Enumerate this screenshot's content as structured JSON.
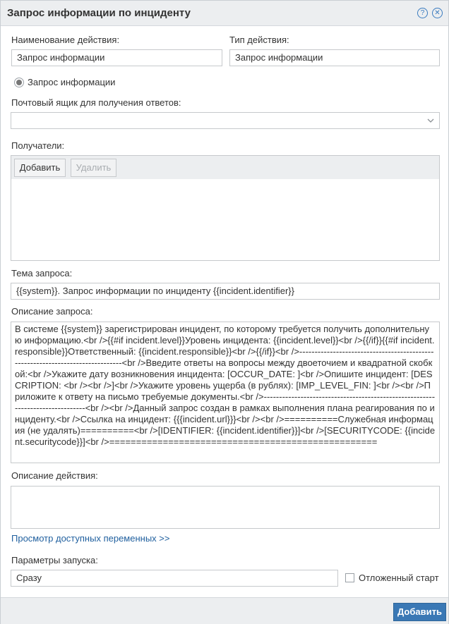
{
  "dialog": {
    "title": "Запрос информации по инциденту",
    "icons": {
      "help": "help-icon",
      "close": "close-icon"
    }
  },
  "form": {
    "action_name": {
      "label": "Наименование действия:",
      "value": "Запрос информации"
    },
    "action_type": {
      "label": "Тип действия:",
      "value": "Запрос информации"
    },
    "radio": {
      "label": "Запрос информации",
      "selected": true
    },
    "mailbox": {
      "label": "Почтовый ящик для получения ответов:",
      "value": ""
    },
    "recipients": {
      "label": "Получатели:",
      "add_label": "Добавить",
      "remove_label": "Удалить"
    },
    "subject": {
      "label": "Тема запроса:",
      "value": "{{system}}. Запрос информации по инциденту {{incident.identifier}}"
    },
    "description": {
      "label": "Описание запроса:",
      "value": "В системе {{system}} зарегистрирован инцидент, по которому требуется получить дополнительную информацию.<br />{{#if incident.level}}Уровень инцидента: {{incident.level}}<br />{{/if}}{{#if incident.responsible}}Ответственный: {{incident.responsible}}<br />{{/if}}<br />-------------------------------------------------------------------------------<br />Введите ответы на вопросы между двоеточием и квадратной скобкой:<br />Укажите дату возникновения инцидента: [OCCUR_DATE: ]<br />Опишите инцидент: [DESCRIPTION: <br /><br />]<br />Укажите уровень ущерба (в рублях): [IMP_LEVEL_FIN: ]<br /><br />Приложите к ответу на письмо требуемые документы.<br />-------------------------------------------------------------------------------<br /><br />Данный запрос создан в рамках выполнения плана реагирования по инциденту.<br />Ссылка на инцидент: {{{incident.url}}}<br /><br />==========Служебная информация (не удалять)==========<br />[IDENTIFIER: {{incident.identifier}}]<br />[SECURITYCODE: {{incident.securitycode}}]<br />=================================================="
    },
    "action_description": {
      "label": "Описание действия:",
      "value": ""
    },
    "variables_link": "Просмотр доступных переменных >>",
    "launch": {
      "label": "Параметры запуска:",
      "value": "Сразу"
    },
    "delayed_start": {
      "label": "Отложенный старт",
      "checked": false
    }
  },
  "footer": {
    "submit_label": "Добавить"
  },
  "colors": {
    "accent": "#3a78b5",
    "link": "#1f5f9e",
    "titlebar": "#eceef0"
  }
}
